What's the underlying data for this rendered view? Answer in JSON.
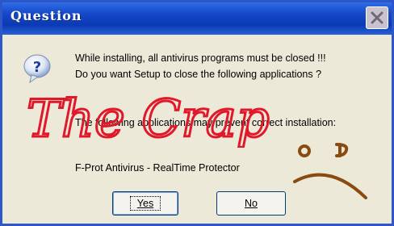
{
  "dialog": {
    "title": "Question",
    "line1": "While installing, all antivirus programs must be closed !!!",
    "line2": "Do you want Setup to close the following applications ?",
    "line3": "The following applications may prevent correct installation:",
    "app_name": "F-Prot Antivirus - RealTime Protector",
    "yes_label": "Yes",
    "no_label": "No"
  },
  "annotation": {
    "handwriting": "The Crap",
    "ink_color": "#e0182a",
    "face_color": "#8a4a10"
  },
  "icons": {
    "question": "question-icon",
    "close": "close-icon"
  },
  "colors": {
    "titlebar": "#1648c8",
    "window": "#ece9d8"
  }
}
